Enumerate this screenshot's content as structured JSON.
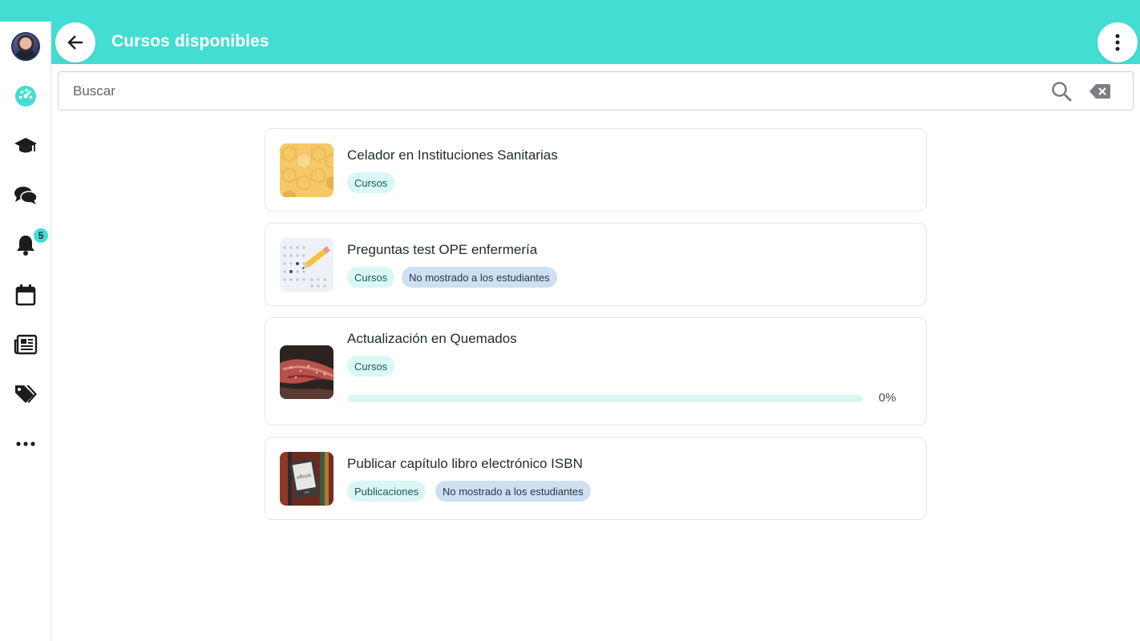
{
  "header": {
    "title": "Cursos disponibles",
    "back_icon": "arrow-left-icon",
    "menu_icon": "more-vertical-icon"
  },
  "sidebar": {
    "items": [
      {
        "name": "user-avatar"
      },
      {
        "name": "dashboard-icon"
      },
      {
        "name": "graduation-cap-icon"
      },
      {
        "name": "chat-bubbles-icon"
      },
      {
        "name": "bell-icon",
        "badge": "5"
      },
      {
        "name": "calendar-icon"
      },
      {
        "name": "newspaper-icon"
      },
      {
        "name": "tags-icon"
      },
      {
        "name": "more-horizontal-icon"
      }
    ]
  },
  "search": {
    "placeholder": "Buscar",
    "value": ""
  },
  "courses": [
    {
      "title": "Celador en Instituciones Sanitarias",
      "category": "Cursos",
      "thumbnail": "honeycomb-pattern"
    },
    {
      "title": "Preguntas test OPE enfermería",
      "category": "Cursos",
      "visibility": "No mostrado a los estudiantes",
      "thumbnail": "test-answer-sheet-pencil"
    },
    {
      "title": "Actualización en Quemados",
      "category": "Cursos",
      "progress": 0,
      "progress_label": "0%",
      "thumbnail": "burned-hand"
    },
    {
      "title": "Publicar capítulo libro electrónico ISBN",
      "category": "Publicaciones",
      "visibility": "No mostrado a los estudiantes",
      "thumbnail": "ebook-reader"
    }
  ],
  "colors": {
    "accent": "#43ddd3",
    "chip_category": "#d9f7f4",
    "chip_hidden": "#cde0f2"
  }
}
